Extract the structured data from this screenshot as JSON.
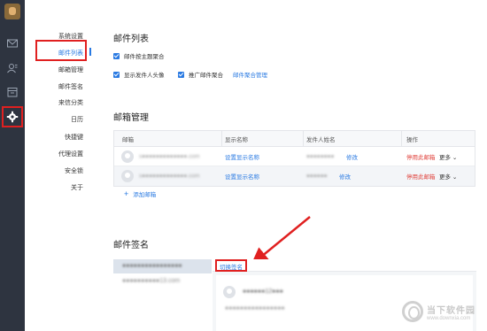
{
  "rail": {
    "icons": [
      "avatar-icon",
      "mail-icon",
      "contacts-icon",
      "calendar-icon",
      "gear-icon"
    ]
  },
  "menu": {
    "items": [
      "系统设置",
      "邮件列表",
      "邮箱管理",
      "邮件签名",
      "来信分类",
      "日历",
      "快捷键",
      "代理设置",
      "安全锁",
      "关于"
    ],
    "active_index": 1
  },
  "mail_list": {
    "title": "邮件列表",
    "options": {
      "merge_by_subject": "邮件按主题聚合",
      "show_sender_avatar": "显示发件人头像",
      "promo_aggregation": "推广邮件聚合",
      "manage_aggregation_link": "邮件聚合管理"
    }
  },
  "mailbox_mgmt": {
    "title": "邮箱管理",
    "columns": [
      "邮箱",
      "显示名称",
      "发件人姓名",
      "操作"
    ],
    "rows": [
      {
        "email": "s●●●●●●●●●●●●●.com",
        "display_name": "设置显示名称",
        "sender_name": "●●●●●●●●",
        "edit": "修改",
        "stop": "停用此邮箱",
        "more": "更多"
      },
      {
        "email": "s●●●●●●●●●●●●●.com",
        "display_name": "设置显示名称",
        "sender_name": "●●●●●●",
        "edit": "修改",
        "stop": "停用此邮箱",
        "more": "更多"
      }
    ],
    "add_label": "添加邮箱"
  },
  "signature": {
    "title": "邮件签名",
    "list": [
      "●●●●●●●●●●●●●●●●",
      "●●●●●●●●●●13.com"
    ],
    "switch_label": "切换签名",
    "preview_name": "●●●●●●12●●●",
    "preview_line": "●●●●●●●●●●●●●●●●"
  },
  "watermark": {
    "brand": "当下软件园",
    "url": "www.downxia.com"
  },
  "colors": {
    "accent": "#2a7ae2",
    "highlight": "#e02020",
    "rail_bg": "#2e3440",
    "danger": "#e0403a"
  }
}
